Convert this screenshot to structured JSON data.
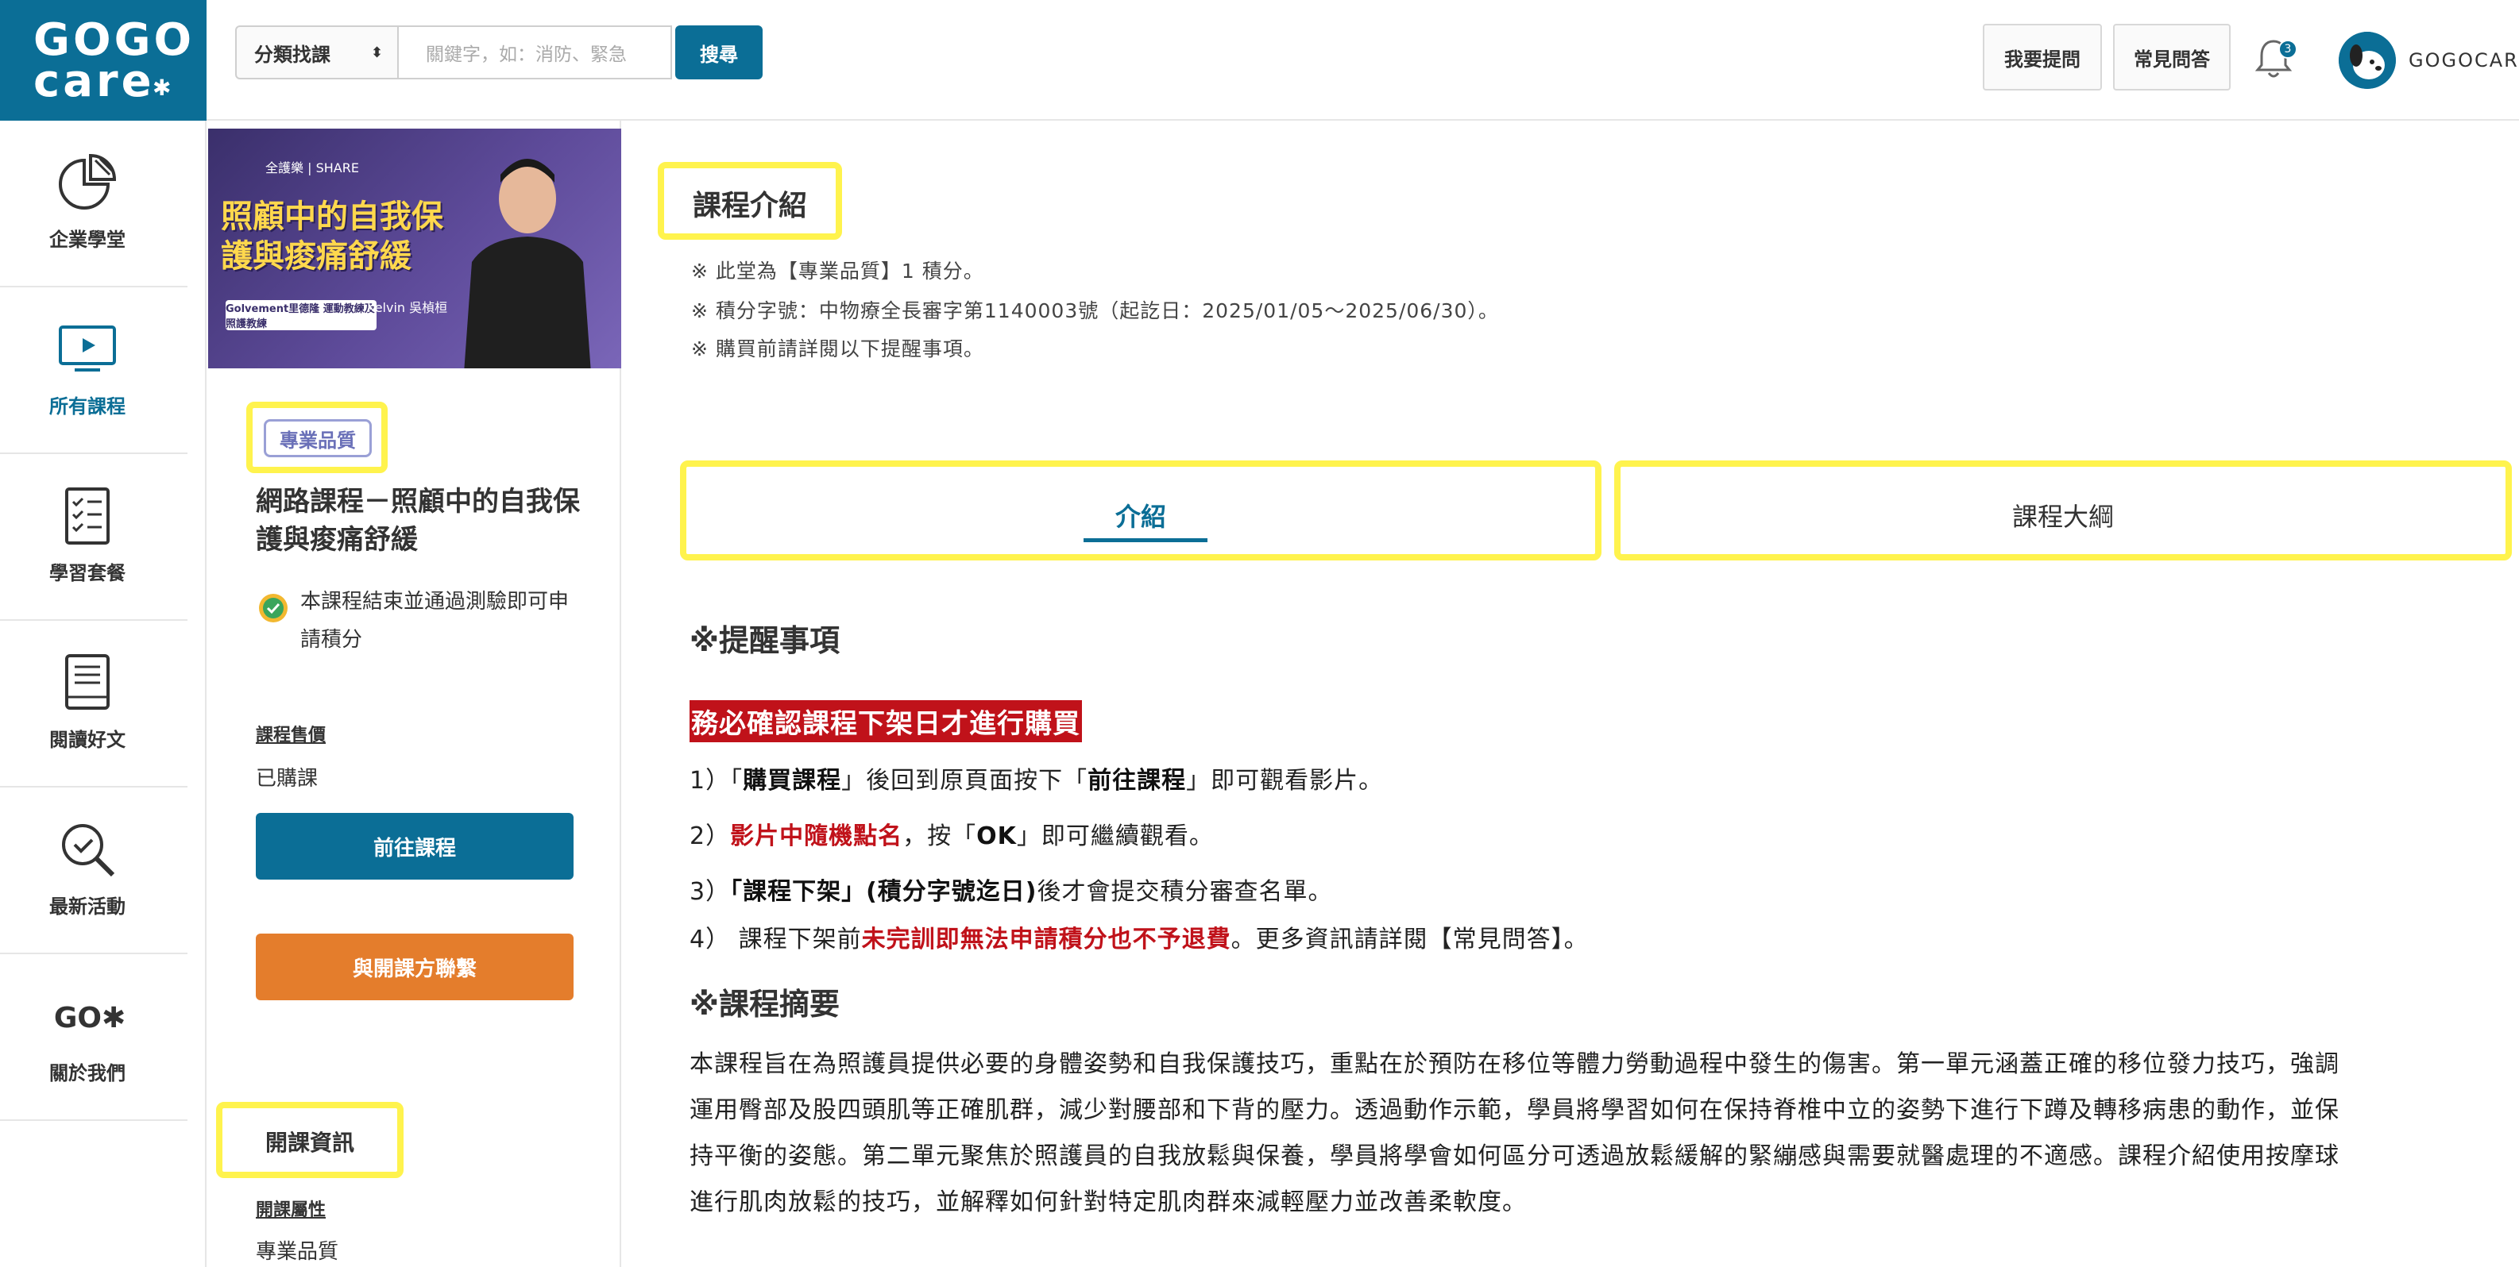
{
  "logo": {
    "line1": "GOGO",
    "line2": "care",
    "star": "✱"
  },
  "search": {
    "category": "分類找課",
    "placeholder": "關鍵字，如：消防、緊急",
    "button": "搜尋"
  },
  "header": {
    "ask_button": "我要提問",
    "faq_button": "常見問答",
    "notification_count": "3",
    "username": "GOGOCARE"
  },
  "nav": [
    {
      "label": "企業學堂",
      "icon": "pie-chart-icon"
    },
    {
      "label": "所有課程",
      "icon": "video-screen-icon",
      "active": true
    },
    {
      "label": "學習套餐",
      "icon": "checklist-icon"
    },
    {
      "label": "閱讀好文",
      "icon": "book-icon"
    },
    {
      "label": "最新活動",
      "icon": "magnify-check-icon"
    },
    {
      "label": "關於我們",
      "icon": "go-logo-icon",
      "mark": "GO✱"
    }
  ],
  "banner": {
    "brand": "全護樂 | SHARE",
    "title": "照顧中的自我保護與痠痛舒緩",
    "tag": "Golvement里德隆 運動教練及照護教練",
    "instructor": "Kelvin 吳楨桓"
  },
  "course": {
    "category_badge": "專業品質",
    "title": "網路課程－照顧中的自我保護與痠痛舒緩",
    "credit_note": "本課程結束並通過測驗即可申請積分",
    "price_label": "課程售價",
    "price_value": "已購課",
    "go_button": "前往課程",
    "contact_button": "與開課方聯繫",
    "info_title": "開課資訊",
    "attr_label": "開課屬性",
    "attr_value": "專業品質"
  },
  "main": {
    "intro_title": "課程介紹",
    "notes": [
      "※ 此堂為【專業品質】1 積分。",
      "※ 積分字號：中物療全長審字第1140003號（起訖日：2025/01/05～2025/06/30）。",
      "※ 購買前請詳閱以下提醒事項。"
    ],
    "tabs": [
      "介紹",
      "課程大綱"
    ],
    "reminder_heading": "※提醒事項",
    "warning": "務必確認課程下架日才進行購買",
    "steps": {
      "s1": {
        "a": "1）「",
        "b": "購買課程",
        "c": "」後回到原頁面按下「",
        "d": "前往課程",
        "e": "」即可觀看影片。"
      },
      "s2": {
        "a": "2）",
        "b": "影片中隨機點名",
        "c": "，按「",
        "d": "OK",
        "e": "」即可繼續觀看。"
      },
      "s3": {
        "a": "3）",
        "b": "「課程下架」(積分字號迄日)",
        "c": "後才會提交積分審查名單。"
      },
      "s4": {
        "a": "4） 課程下架前",
        "b": "未完訓即無法申請積分也不予退費",
        "c": "。更多資訊請詳閱【常見問答】。"
      }
    },
    "summary_heading": "※課程摘要",
    "summary_lines": [
      "本課程旨在為照護員提供必要的身體姿勢和自我保護技巧，重點在於預防在移位等體力勞動過程中發生的傷害。第一單元涵蓋正確的移位發力技巧，強調",
      "運用臀部及股四頭肌等正確肌群，減少對腰部和下背的壓力。透過動作示範，學員將學習如何在保持脊椎中立的姿勢下進行下蹲及轉移病患的動作，並保",
      "持平衡的姿態。第二單元聚焦於照護員的自我放鬆與保養，學員將學會如何區分可透過放鬆緩解的緊繃感與需要就醫處理的不適感。課程介紹使用按摩球",
      "進行肌肉放鬆的技巧，並解釋如何針對特定肌肉群來減輕壓力並改善柔軟度。"
    ]
  },
  "colors": {
    "brand": "#0b6e96",
    "accent_orange": "#e47d2c",
    "warning_red": "#c0121a",
    "highlight": "#fff34d"
  }
}
